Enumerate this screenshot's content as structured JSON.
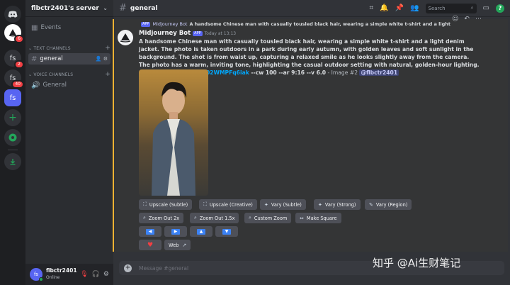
{
  "servers": [
    {
      "label": "",
      "badge": "6"
    },
    {
      "label": "fs",
      "badge": "2"
    },
    {
      "label": "fs",
      "badge": "40"
    },
    {
      "label": "fs",
      "badge": ""
    }
  ],
  "sidebar": {
    "server_name": "flbctr2401's server",
    "events_label": "Events",
    "text_category": "TEXT CHANNELS",
    "voice_category": "VOICE CHANNELS",
    "text_channel": "general",
    "voice_channel": "General"
  },
  "user": {
    "name": "flbctr2401",
    "status": "Online",
    "avatar_text": "fs"
  },
  "header": {
    "channel": "general",
    "search_placeholder": "Search"
  },
  "message": {
    "reply_tag": "APP",
    "reply_author": "Midjourney Bot",
    "reply_text": "A handsome Chinese man with casually tousled black hair, wearing a simple white t-shirt and a light denim jacket. The photo is tak...",
    "author": "Midjourney Bot",
    "app_tag": "APP",
    "timestamp": "Today at 13:13",
    "prompt": "A handsome Chinese man with casually tousled black hair, wearing a simple white t-shirt and a light denim jacket. The photo is taken outdoors in a park during early autumn, with golden leaves and soft sunlight in the background. The shot is from waist up, capturing a relaxed smile as he looks slightly away from the camera. The photo has a warm, inviting tone, highlighting the casual outdoor setting with natural, golden-hour lighting. --cref ",
    "link": "https://s.mj.run/02WMPFq6iak",
    "params": " --cw 100 --ar 9:16 --v 6.0",
    "suffix": " - Image #2 ",
    "mention": "@flbctr2401"
  },
  "buttons": {
    "upscale_subtle": "Upscale (Subtle)",
    "upscale_creative": "Upscale (Creative)",
    "vary_subtle": "Vary (Subtle)",
    "vary_strong": "Vary (Strong)",
    "vary_region": "Vary (Region)",
    "zoom_out_2x": "Zoom Out 2x",
    "zoom_out_15x": "Zoom Out 1.5x",
    "custom_zoom": "Custom Zoom",
    "make_square": "Make Square",
    "web": "Web"
  },
  "composer": {
    "placeholder": "Message #general"
  },
  "watermark": "知乎 @Ai生财笔记",
  "colors": {
    "accent": "#5865f2",
    "link": "#00a8fc",
    "highlight_bar": "#f0b232",
    "online": "#23a55a"
  }
}
